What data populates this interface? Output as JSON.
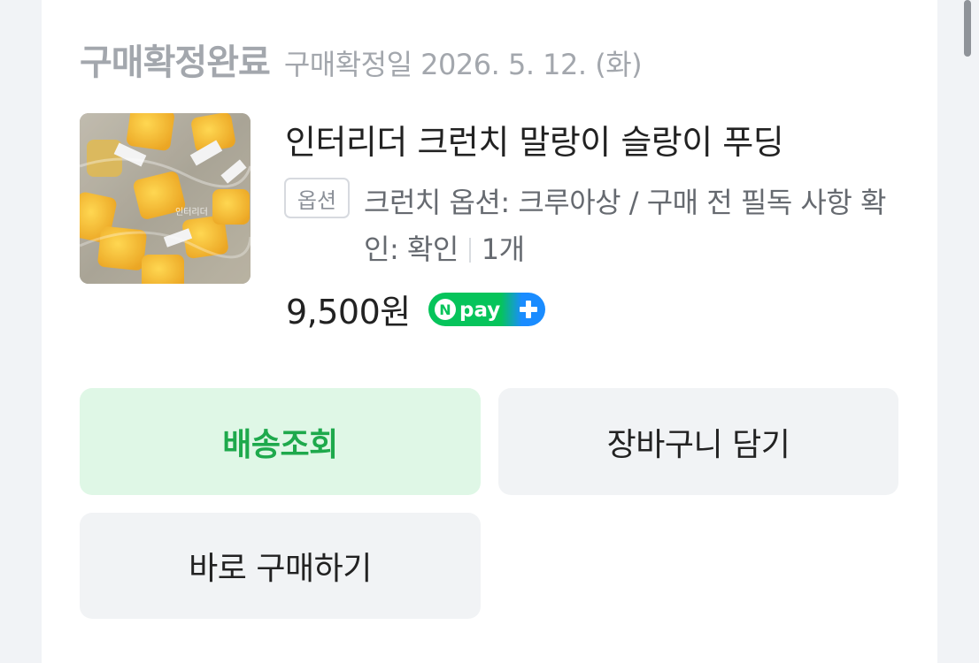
{
  "order": {
    "status": "구매확정완료",
    "confirmed_date": "구매확정일 2026. 5. 12. (화)"
  },
  "product": {
    "name": "인터리더 크런치 말랑이 슬랑이 푸딩",
    "option_badge": "옵션",
    "option_text": "크런치 옵션: 크루아상 / 구매 전 필독 사항 확인: 확인",
    "quantity": "1개",
    "price": "9,500원",
    "payment_badge": "Npay+",
    "thumbnail_watermark": "인터리더"
  },
  "actions": {
    "track_label": "배송조회",
    "cart_label": "장바구니 담기",
    "buy_label": "바로 구매하기"
  },
  "colors": {
    "accent_green": "#1ea94c",
    "track_bg": "#dff7e6",
    "npay_green": "#06c45b",
    "npay_blue": "#1a8cff"
  }
}
